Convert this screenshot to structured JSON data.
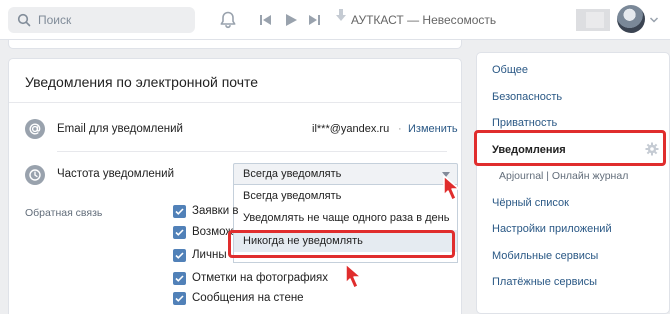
{
  "header": {
    "search_placeholder": "Поиск",
    "track": "АУТКАСТ — Невесомость"
  },
  "card": {
    "title": "Уведомления по электронной почте",
    "email": {
      "label": "Email для уведомлений",
      "value": "il***@yandex.ru",
      "separator": "·",
      "change_link": "Изменить"
    },
    "frequency": {
      "label": "Частота уведомлений",
      "selected": "Всегда уведомлять",
      "options": [
        "Всегда уведомлять",
        "Уведомлять не чаще одного раза в день",
        "Никогда не уведомлять"
      ],
      "highlighted_option": "Никогда не уведомлять"
    },
    "feedback": {
      "label": "Обратная связь",
      "checkboxes": [
        {
          "label": "Заявки в",
          "checked": true
        },
        {
          "label": "Возмож",
          "checked": true
        },
        {
          "label": "Личны",
          "checked": true
        },
        {
          "label": "Отметки на фотографиях",
          "checked": true
        },
        {
          "label": "Сообщения на стене",
          "checked": true
        }
      ]
    }
  },
  "sidebar": {
    "items": [
      {
        "label": "Общее"
      },
      {
        "label": "Безопасность"
      },
      {
        "label": "Приватность"
      },
      {
        "label": "Уведомления",
        "current": true
      },
      {
        "label": "Apjournal | Онлайн журнал",
        "sub": true
      },
      {
        "label": "Чёрный список"
      },
      {
        "label": "Настройки приложений"
      },
      {
        "label": "Мобильные сервисы"
      },
      {
        "label": "Платёжные сервисы"
      }
    ]
  },
  "colors": {
    "accent": "#5181b8",
    "link": "#2a5885",
    "highlight": "#e02d2d",
    "background": "#edeef0"
  }
}
